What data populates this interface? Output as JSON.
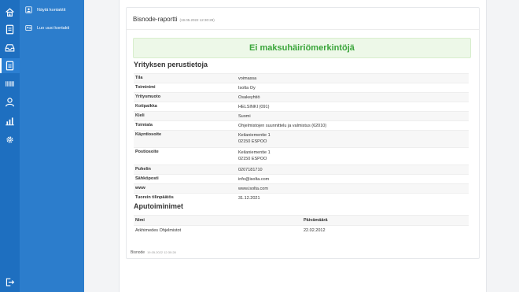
{
  "rail": {
    "icons": [
      "home-icon",
      "document-icon",
      "inbox-icon",
      "contact-card-icon",
      "barcode-icon",
      "user-icon",
      "chart-icon",
      "settings-icon",
      "logout-icon"
    ],
    "active_index": 3
  },
  "subnav": {
    "items": [
      {
        "label": "Näytä kontaktit",
        "icon": "contact-list-icon"
      },
      {
        "label": "Luo uusi kontakti",
        "icon": "add-contact-icon"
      }
    ]
  },
  "report": {
    "title": "Bisnode-raportti",
    "timestamp": "(19.05.2022 12:30:28)",
    "alert": "Ei maksuhäiriömerkintöjä"
  },
  "basic": {
    "title": "Yrityksen perustietoja",
    "rows": [
      {
        "k": "Tila",
        "v": [
          "voimassa"
        ]
      },
      {
        "k": "Toiminimi",
        "v": [
          "Isolta Oy"
        ]
      },
      {
        "k": "Yritysmuoto",
        "v": [
          "Osakeyhtiö"
        ]
      },
      {
        "k": "Kotipaikka",
        "v": [
          "HELSINKI (091)"
        ]
      },
      {
        "k": "Kieli",
        "v": [
          "Suomi"
        ]
      },
      {
        "k": "Toimiala",
        "v": [
          "Ohjelmistojen suunnittelu ja valmistus (62010)"
        ]
      },
      {
        "k": "Käyntiosoite",
        "v": [
          "Keilaniementie 1",
          "02150 ESPOO"
        ]
      },
      {
        "k": "Postiosoite",
        "v": [
          "Keilaniementie 1",
          "02150 ESPOO"
        ]
      },
      {
        "k": "Puhelin",
        "v": [
          "0207181710"
        ]
      },
      {
        "k": "Sähköposti",
        "v": [
          "info@isolta.com"
        ]
      },
      {
        "k": "www",
        "v": [
          "www.isolta.com"
        ]
      },
      {
        "k": "Tuorein tilinpäätös",
        "v": [
          "31.12.2021"
        ]
      }
    ]
  },
  "aux": {
    "title": "Aputoiminimet",
    "col_name": "Nimi",
    "col_date": "Päivämäärä",
    "rows": [
      {
        "name": "Arkhimedes Ohjelmistot",
        "date": "22.02.2012"
      }
    ]
  },
  "footer": {
    "label": "Bisnode",
    "timestamp": "19.05.2022 12:30:28"
  },
  "colors": {
    "rail": "#1e6fc0",
    "subnav": "#2c7dcc",
    "alert_text": "#3aa53a",
    "alert_bg": "#edf8e8"
  }
}
